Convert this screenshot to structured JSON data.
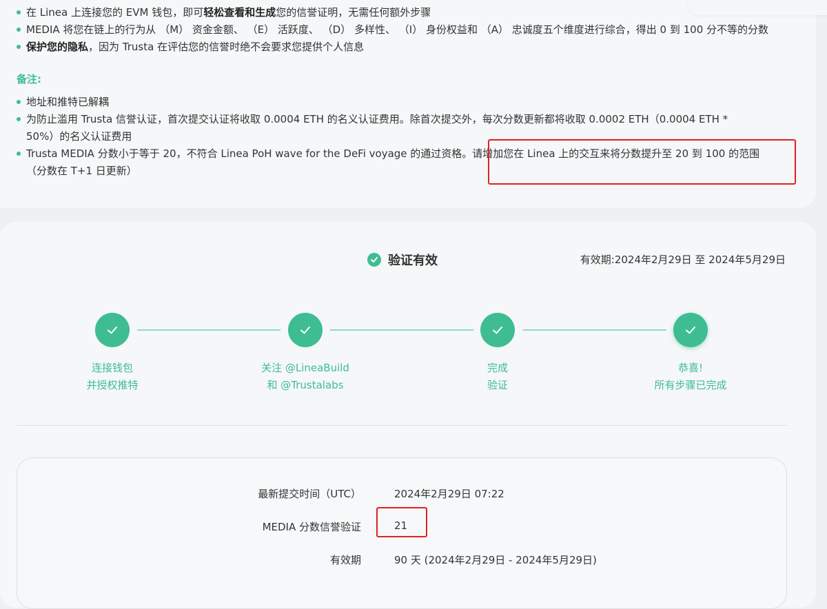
{
  "info": {
    "bullets": [
      {
        "pre": "在 Linea 上连接您的 EVM 钱包，即可",
        "bold": "轻松查看和生成",
        "post": "您的信誉证明，无需任何额外步骤"
      },
      {
        "pre": "MEDIA 将您在链上的行为从 （M） 资金金额、 （E） 活跃度、 （D） 多样性、 （I） 身份权益和 （A） 忠诚度五个维度进行综合，得出 0 到 100 分不等的分数",
        "bold": "",
        "post": ""
      },
      {
        "pre": "",
        "bold": "保护您的隐私",
        "post": "，因为 Trusta 在评估您的信誉时绝不会要求您提供个人信息"
      }
    ],
    "notes_title": "备注:",
    "notes": [
      "地址和推特已解耦",
      "为防止滥用 Trusta 信誉认证，首次提交认证将收取 0.0004 ETH 的名义认证费用。除首次提交外，每次分数更新都将收取 0.0002 ETH（0.0004 ETH *",
      "50%）的名义认证费用",
      "Trusta MEDIA 分数小于等于 20，不符合 Linea PoH wave for the DeFi voyage 的通过资格。请增加您在 Linea 上的交互来将分数提升至 20 到 100 的范围",
      "（分数在 T+1 日更新）"
    ]
  },
  "verify": {
    "status": "验证有效",
    "validity_label": "有效期:",
    "validity_range": "2024年2月29日 至 2024年5月29日",
    "steps": [
      {
        "line1": "连接钱包",
        "line2": "并授权推特"
      },
      {
        "line1": "关注 @LineaBuild",
        "line2": "和 @Trustalabs"
      },
      {
        "line1": "完成",
        "line2": "验证"
      },
      {
        "line1": "恭喜!",
        "line2": "所有步骤已完成"
      }
    ]
  },
  "details": {
    "rows": [
      {
        "label": "最新提交时间（UTC）",
        "value": "2024年2月29日 07:22"
      },
      {
        "label": "MEDIA 分数信誉验证",
        "value": "21"
      },
      {
        "label": "有效期",
        "value": "90 天 (2024年2月29日 - 2024年5月29日)"
      }
    ]
  },
  "colors": {
    "accent": "#3ebd93",
    "highlight": "#e02020"
  }
}
